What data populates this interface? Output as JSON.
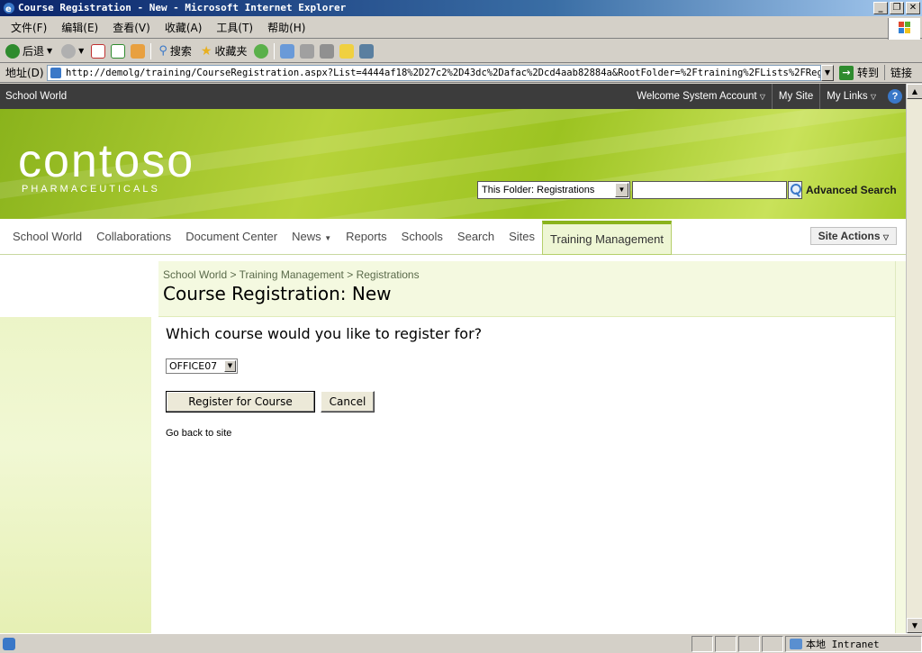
{
  "window": {
    "title": "Course Registration - New - Microsoft Internet Explorer",
    "buttons": [
      "_",
      "❐",
      "✕"
    ]
  },
  "menubar": {
    "items": [
      "文件(F)",
      "编辑(E)",
      "查看(V)",
      "收藏(A)",
      "工具(T)",
      "帮助(H)"
    ]
  },
  "toolbar": {
    "back_label": "后退",
    "search_label": "搜索",
    "favorites_label": "收藏夹"
  },
  "addressbar": {
    "label": "地址(D)",
    "url": "http://demolg/training/CourseRegistration.aspx?List=4444af18%2D27c2%2D43dc%2Dafac%2Dcd4aab82884a&RootFolder=%2Ftraining%2FLists%2FRegistrat",
    "go_label": "转到",
    "links_label": "链接"
  },
  "sp_topbar": {
    "site_name": "School World",
    "welcome": "Welcome System Account",
    "my_site": "My Site",
    "my_links": "My Links"
  },
  "banner": {
    "logo": "contoso",
    "logo_sub": "PHARMACEUTICALS",
    "search_scope": "This Folder: Registrations",
    "search_value": "",
    "advanced_search": "Advanced Search"
  },
  "nav": {
    "tabs": [
      "School World",
      "Collaborations",
      "Document Center",
      "News",
      "Reports",
      "Schools",
      "Search",
      "Sites",
      "Training Management"
    ],
    "active_tab": "Training Management",
    "site_actions": "Site Actions"
  },
  "title_area": {
    "breadcrumb": "School World > Training Management > Registrations",
    "page_title": "Course Registration: New"
  },
  "form": {
    "question": "Which course would you like to register for?",
    "course_selected": "OFFICE07",
    "register_label": "Register for Course",
    "cancel_label": "Cancel",
    "go_back": "Go back to site"
  },
  "statusbar": {
    "zone": "本地 Intranet"
  },
  "colors": {
    "banner_green": "#9cc321",
    "topbar_dark": "#3c3c3c",
    "ie_title_blue": "#0a246a"
  }
}
